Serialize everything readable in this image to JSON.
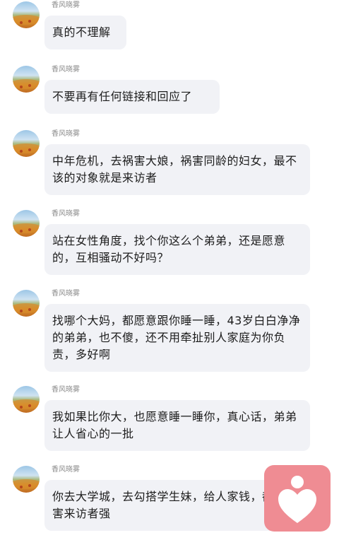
{
  "messages": [
    {
      "sender": "香风晓雾",
      "text": "真的不理解"
    },
    {
      "sender": "香风晓雾",
      "text": "不要再有任何链接和回应了"
    },
    {
      "sender": "香风晓雾",
      "text": "中年危机，去祸害大娘，祸害同龄的妇女，最不该的对象就是来访者"
    },
    {
      "sender": "香风晓雾",
      "text": "站在女性角度，找个你这么个弟弟，还是愿意的，互相骚动不好吗？"
    },
    {
      "sender": "香风晓雾",
      "text": "找哪个大妈，都愿意跟你睡一睡，43岁白白净净的弟弟，也不傻，还不用牵扯别人家庭为你负责，多好啊"
    },
    {
      "sender": "香风晓雾",
      "text": "我如果比你大，也愿意睡一睡你，真心话，弟弟让人省心的一批"
    },
    {
      "sender": "香风晓雾",
      "text": "你去大学城，去勾搭学生妹，给人家钱，都比祸害来访者强"
    }
  ],
  "logo": {
    "icon": "heart-person-icon",
    "color": "#ef8c93"
  }
}
